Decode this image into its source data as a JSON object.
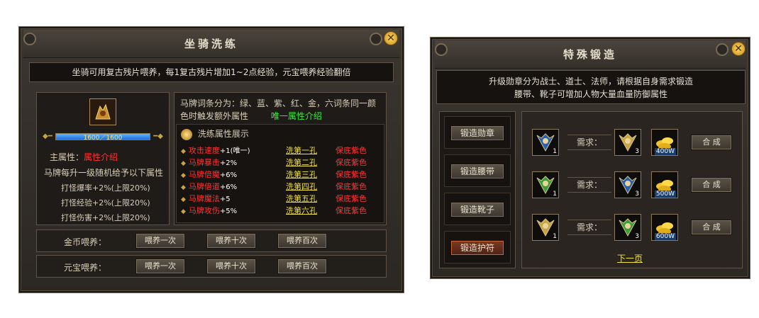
{
  "mount": {
    "title": "坐骑洗练",
    "notice": "坐骑可用复古残片喂养，每1复古残片增加1~2点经验，元宝喂养经验翻倍",
    "exp_text": "1600／1600",
    "exp_fraction": 1.0,
    "main_attr_label": "主属性：",
    "main_attr_link": "属性介绍",
    "levelup_text": "马牌每升一级随机给予以下属性",
    "bonuses": [
      "打怪爆率+2%(上限20%)",
      "打怪经验+2%(上限20%)",
      "打怪伤害+2%(上限20%)"
    ],
    "desc_line1": "马牌词条分为：绿、蓝、紫、红、金，六词条同一颜",
    "desc_line2": "色时触发额外属性",
    "unique_link": "唯一属性介绍",
    "show_title": "洗练属性展示",
    "rows": [
      {
        "name": "攻击速度",
        "value": "+1(唯一)",
        "hole": "洗第一孔",
        "guarantee": "保底紫色"
      },
      {
        "name": "马牌暴击",
        "value": "+2%",
        "hole": "洗第二孔",
        "guarantee": "保底紫色"
      },
      {
        "name": "马牌倍魔",
        "value": "+6%",
        "hole": "洗第三孔",
        "guarantee": "保底紫色"
      },
      {
        "name": "马牌倍道",
        "value": "+6%",
        "hole": "洗第四孔",
        "guarantee": "保底紫色"
      },
      {
        "name": "马牌魔法",
        "value": "+5",
        "hole": "洗第五孔",
        "guarantee": "保底紫色"
      },
      {
        "name": "马牌攻伤",
        "value": "+5%",
        "hole": "洗第六孔",
        "guarantee": "保底紫色"
      }
    ],
    "gold_label": "金币喂养：",
    "yuanbao_label": "元宝喂养：",
    "feed_buttons": [
      "喂养一次",
      "喂养十次",
      "喂养百次"
    ]
  },
  "forge": {
    "title": "特殊锻造",
    "notice_line1": "升级勋章分为战士、道士、法师，请根据自身需求锻造",
    "notice_line2": "腰带、靴子可增加人物大量血量防御属性",
    "tabs": [
      "锻造勋章",
      "锻造腰带",
      "锻造靴子",
      "锻造护符"
    ],
    "active_tab_index": 3,
    "need_label": "需求：",
    "compose_label": "合 成",
    "recipes": [
      {
        "own": "1",
        "need": "3",
        "price": "400W",
        "own_color": "#2a5fb0",
        "need_color": "#c9a443"
      },
      {
        "own": "1",
        "need": "3",
        "price": "500W",
        "own_color": "#3c9e3a",
        "need_color": "#2a5fb0"
      },
      {
        "own": "1",
        "need": "3",
        "price": "600W",
        "own_color": "#c9a443",
        "need_color": "#3c9e3a"
      }
    ],
    "next_page": "下一页"
  },
  "colors": {
    "accent_red": "#ff3535",
    "accent_green": "#3bea3b",
    "link_yellow": "#f3e23a",
    "exp_blue": "#2e8cff"
  }
}
